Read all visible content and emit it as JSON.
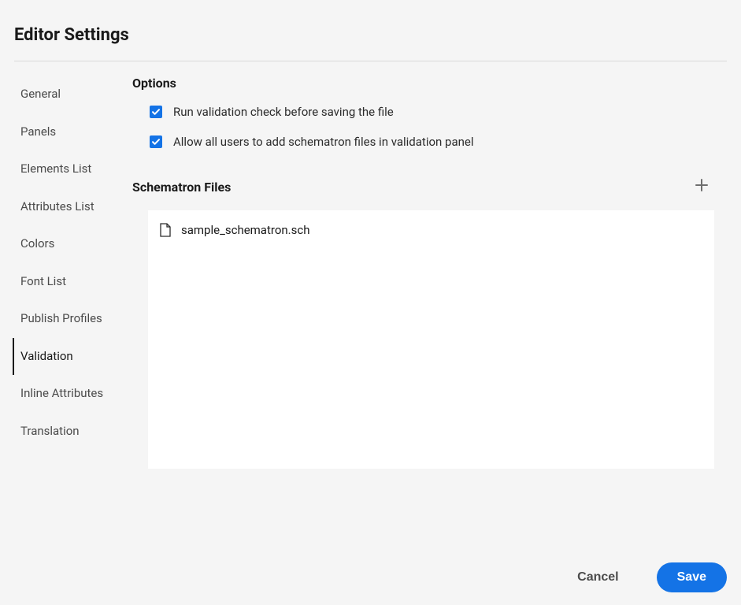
{
  "header": {
    "title": "Editor Settings"
  },
  "sidebar": {
    "items": [
      {
        "label": "General",
        "slug": "general"
      },
      {
        "label": "Panels",
        "slug": "panels"
      },
      {
        "label": "Elements List",
        "slug": "elements-list"
      },
      {
        "label": "Attributes List",
        "slug": "attributes-list"
      },
      {
        "label": "Colors",
        "slug": "colors"
      },
      {
        "label": "Font List",
        "slug": "font-list"
      },
      {
        "label": "Publish Profiles",
        "slug": "publish-profiles"
      },
      {
        "label": "Validation",
        "slug": "validation"
      },
      {
        "label": "Inline Attributes",
        "slug": "inline-attributes"
      },
      {
        "label": "Translation",
        "slug": "translation"
      }
    ],
    "active_index": 7
  },
  "main": {
    "options_heading": "Options",
    "options": [
      {
        "label": "Run validation check before saving the file",
        "checked": true
      },
      {
        "label": "Allow all users to add schematron files in validation panel",
        "checked": true
      }
    ],
    "schematron_heading": "Schematron Files",
    "schematron_files": [
      {
        "name": "sample_schematron.sch"
      }
    ]
  },
  "footer": {
    "cancel_label": "Cancel",
    "save_label": "Save"
  },
  "colors": {
    "accent": "#1473e6"
  }
}
